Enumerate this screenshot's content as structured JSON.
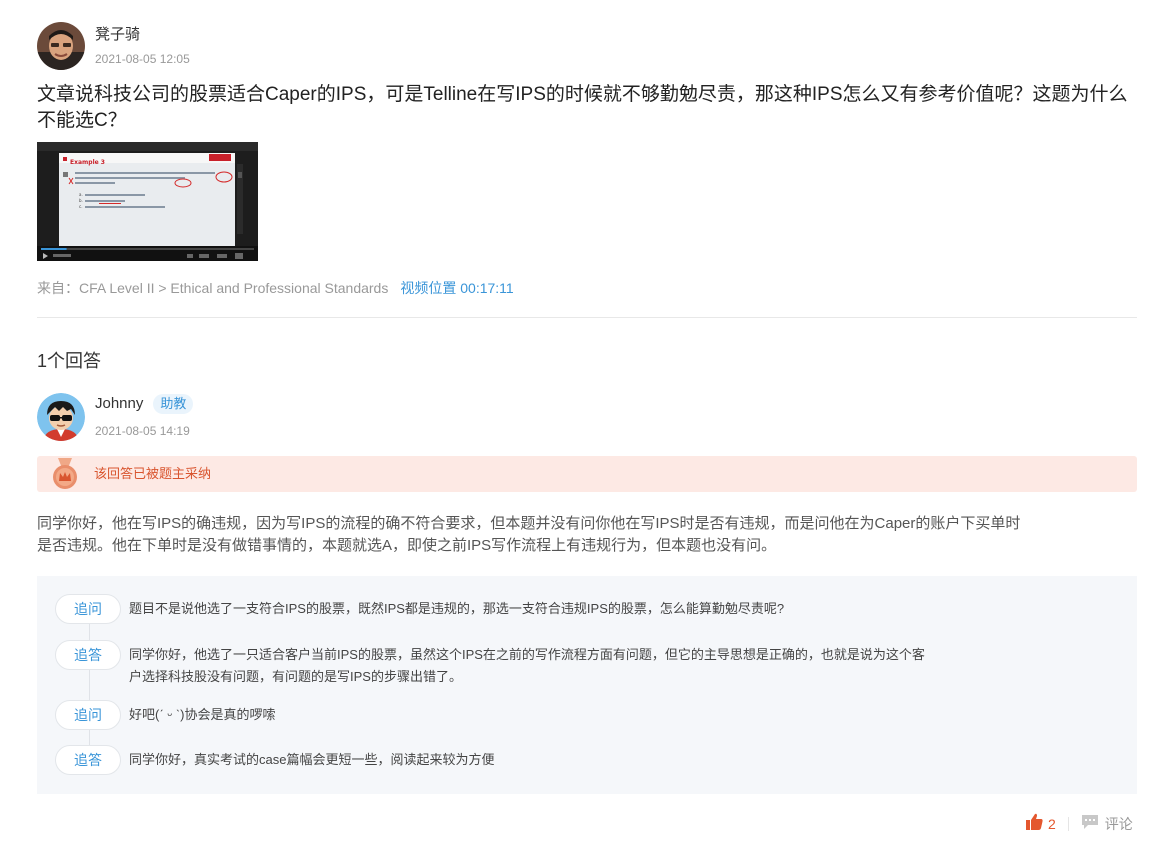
{
  "question": {
    "author": "凳子骑",
    "time": "2021-08-05 12:05",
    "text": "文章说科技公司的股票适合Caper的IPS，可是Telline在写IPS的时候就不够勤勉尽责，那这种IPS怎么又有参考价值呢？这题为什么不能选C？",
    "source": "来自：CFA Level II > Ethical and Professional Standards",
    "video_position": "视频位置 00:17:11",
    "thumbnail": {
      "heading": "Example 3",
      "lines": [
        "a.",
        "b.",
        "c."
      ],
      "progress": 0.12
    }
  },
  "answers": {
    "count_label": "1个回答"
  },
  "answer": {
    "author": "Johnny",
    "role": "助教",
    "time": "2021-08-05 14:19",
    "accepted_text": "该回答已被题主采纳",
    "text": "同学你好，他在写IPS的确违规，因为写IPS的流程的确不符合要求，但本题并没有问你他在写IPS时是否有违规，而是问他在为Caper的账户下买单时是否违规。他在下单时是没有做错事情的，本题就选A，即使之前IPS写作流程上有违规行为，但本题也没有问。"
  },
  "thread": [
    {
      "tag": "追问",
      "text": "题目不是说他选了一支符合IPS的股票，既然IPS都是违规的，那选一支符合违规IPS的股票，怎么能算勤勉尽责呢?"
    },
    {
      "tag": "追答",
      "text": "同学你好，他选了一只适合客户当前IPS的股票，虽然这个IPS在之前的写作流程方面有问题，但它的主导思想是正确的，也就是说为这个客户选择科技股没有问题，有问题的是写IPS的步骤出错了。"
    },
    {
      "tag": "追问",
      "text": "好吧(ˊ ᵕ ˋ)协会是真的啰嗦"
    },
    {
      "tag": "追答",
      "text": "同学你好，真实考试的case篇幅会更短一些，阅读起来较为方便"
    }
  ],
  "actions": {
    "like_count": "2",
    "comment_label": "评论"
  },
  "colors": {
    "accent": "#3a95d8",
    "accepted_bg": "#fde9e4",
    "accepted_text": "#d9552f",
    "like": "#e4572e"
  }
}
